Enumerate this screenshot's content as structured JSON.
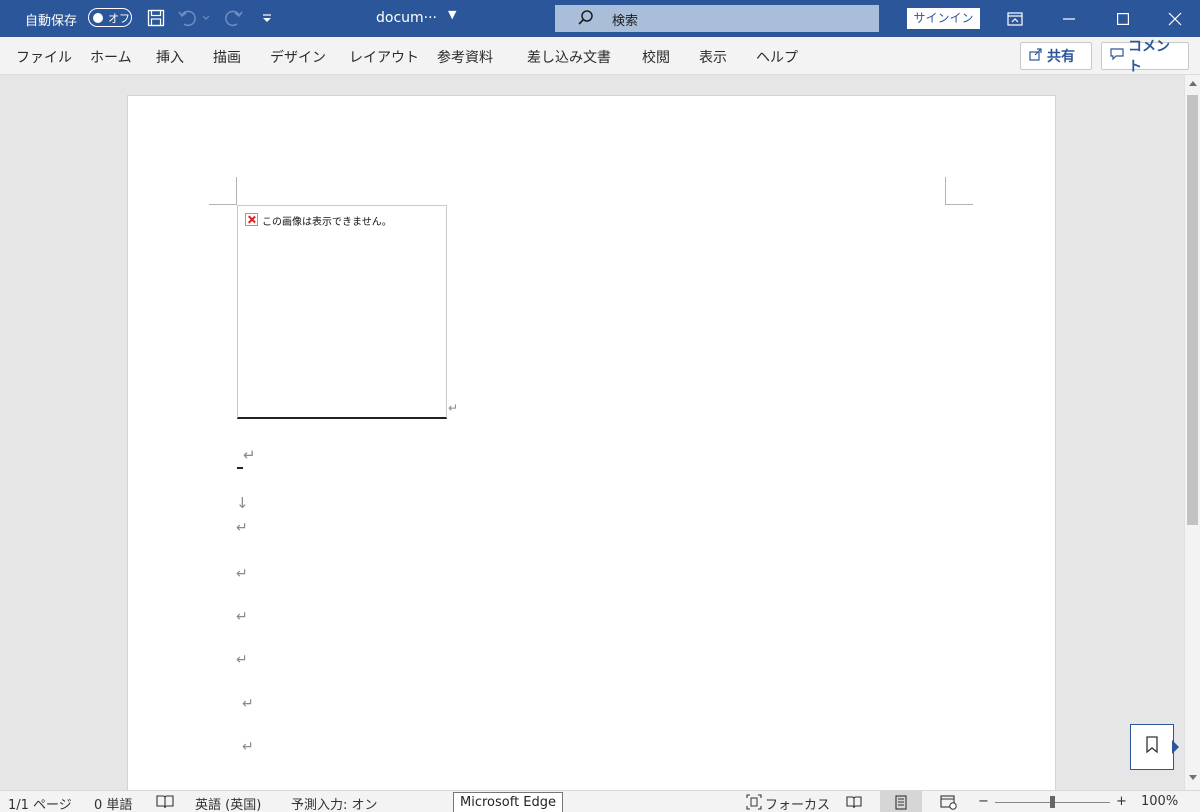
{
  "titlebar": {
    "autosave_label": "自動保存",
    "autosave_state": "オフ",
    "doc_title": "docum···",
    "search_label": "検索",
    "signin_label": "サインイン",
    "accent_color": "#2b579a"
  },
  "ribbon": {
    "tabs": [
      "ファイル",
      "ホーム",
      "挿入",
      "描画",
      "デザイン",
      "レイアウト",
      "参考資料",
      "差し込み文書",
      "校閲",
      "表示",
      "ヘルプ"
    ],
    "share_label": "共有",
    "comment_label": "コメント"
  },
  "document": {
    "image_error": "この画像は表示できません。",
    "paragraph_mark": "↵",
    "line_break_mark": "↓"
  },
  "statusbar": {
    "page": "1/1 ページ",
    "words": "0 単語",
    "language": "英語 (英国)",
    "predictive": "予測入力: オン",
    "tooltip": "Microsoft Edge",
    "focus": "フォーカス",
    "zoom_minus": "−",
    "zoom_plus": "+",
    "zoom": "100%"
  },
  "icons": {
    "save": "save-icon",
    "undo": "undo-icon",
    "redo": "redo-icon",
    "customize": "customize-quick-access-icon",
    "search": "search-icon",
    "ribbon_display": "ribbon-display-options-icon",
    "minimize": "minimize-icon",
    "maximize": "maximize-icon",
    "close": "close-icon",
    "share": "share-icon",
    "comment": "comment-icon",
    "proofing": "proofing-book-icon",
    "bookmark": "bookmark-icon"
  }
}
